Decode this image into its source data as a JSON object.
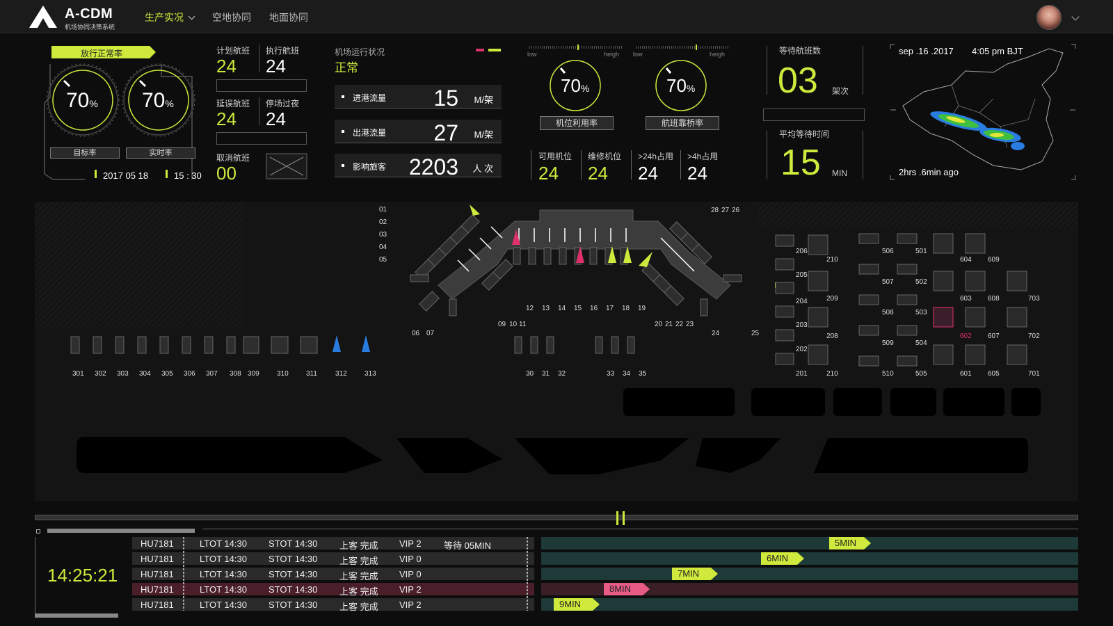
{
  "header": {
    "brand": "A-CDM",
    "brand_sub": "机场协同决策系统",
    "nav": [
      {
        "label": "生产实况",
        "active": true
      },
      {
        "label": "空地协同",
        "active": false
      },
      {
        "label": "地面协同",
        "active": false
      }
    ]
  },
  "release": {
    "title": "放行正常率",
    "target_rate": "70",
    "actual_rate": "70",
    "unit": "%",
    "target_label": "目标率",
    "actual_label": "实时率",
    "date": "2017 05 18",
    "time": "15 : 30"
  },
  "flights": {
    "planned_label": "计划航班",
    "planned": "24",
    "executed_label": "执行航班",
    "executed": "24",
    "delayed_label": "延误航班",
    "delayed": "24",
    "overnight_label": "停场过夜",
    "overnight": "24",
    "cancel_label": "取消航班",
    "cancel": "00"
  },
  "airport_status": {
    "label": "机场运行状况",
    "value": "正常",
    "rows": [
      {
        "name": "进港流量",
        "value": "15",
        "unit": "M/架"
      },
      {
        "name": "出港流量",
        "value": "27",
        "unit": "M/架"
      },
      {
        "name": "影响旅客",
        "value": "2203",
        "unit": "人 次"
      }
    ]
  },
  "utilization": {
    "low": "low",
    "high": "heigh",
    "stand_rate": "70",
    "stand_rate_label": "机位利用率",
    "bridge_rate": "70",
    "bridge_rate_label": "航班靠桥率",
    "unit": "%",
    "stats": [
      {
        "label": "可用机位",
        "value": "24"
      },
      {
        "label": "维修机位",
        "value": "24"
      },
      {
        "label": ">24h占用",
        "value": "24"
      },
      {
        "label": ">4h占用",
        "value": "24"
      }
    ]
  },
  "waiting": {
    "count_label": "等待航班数",
    "count": "03",
    "count_unit": "架次",
    "avg_label": "平均等待时间",
    "avg": "15",
    "avg_unit": "MIN"
  },
  "weather": {
    "date": "sep .16 .2017",
    "time": "4:05 pm  BJT",
    "ago": "2hrs .6min ago"
  },
  "apron": {
    "remote_left": [
      "301",
      "302",
      "303",
      "304",
      "305",
      "306",
      "307",
      "308",
      "309",
      "310",
      "311",
      "312",
      "313"
    ],
    "pier_left": [
      "01",
      "02",
      "03",
      "04",
      "05"
    ],
    "bottom_mid": [
      "06",
      "07",
      "09",
      "10",
      "11",
      "12",
      "13",
      "14",
      "15",
      "16",
      "17",
      "18",
      "19",
      "20",
      "21",
      "22",
      "23",
      "24",
      "25"
    ],
    "top_right": [
      "28",
      "27",
      "26"
    ],
    "bottom_row": [
      "30",
      "31",
      "32",
      "33",
      "34",
      "35"
    ],
    "east_col1": [
      "206",
      "205",
      "204",
      "203",
      "202",
      "201"
    ],
    "east_col2": [
      "210",
      "209",
      "208",
      "210"
    ],
    "east_col3": [
      "506",
      "507",
      "508",
      "509",
      "510"
    ],
    "east_col4": [
      "501",
      "502",
      "503",
      "504",
      "505"
    ],
    "east_col5": [
      "604",
      "603",
      "602",
      "601"
    ],
    "east_col6": [
      "609",
      "608",
      "607",
      "605"
    ],
    "east_col7": [
      "703",
      "702",
      "701"
    ]
  },
  "timeline": {
    "clock": "14:25:21",
    "rows": [
      {
        "flight": "HU7181",
        "ltot": "LTOT  14:30",
        "stot": "STOT  14:30",
        "board": "上客  完成",
        "vip": "VIP  2",
        "wait": "等待  05MIN",
        "bar": "5MIN",
        "alert": false
      },
      {
        "flight": "HU7181",
        "ltot": "LTOT  14:30",
        "stot": "STOT  14:30",
        "board": "上客  完成",
        "vip": "VIP  0",
        "wait": "",
        "bar": "6MIN",
        "alert": false
      },
      {
        "flight": "HU7181",
        "ltot": "LTOT  14:30",
        "stot": "STOT  14:30",
        "board": "上客  完成",
        "vip": "VIP  0",
        "wait": "",
        "bar": "7MIN",
        "alert": false
      },
      {
        "flight": "HU7181",
        "ltot": "LTOT  14:30",
        "stot": "STOT  14:30",
        "board": "上客  完成",
        "vip": "VIP  2",
        "wait": "",
        "bar": "8MIN",
        "alert": true
      },
      {
        "flight": "HU7181",
        "ltot": "LTOT  14:30",
        "stot": "STOT  14:30",
        "board": "上客  完成",
        "vip": "VIP  2",
        "wait": "",
        "bar": "9MIN",
        "alert": false
      }
    ]
  },
  "colors": {
    "accent": "#cfe93c",
    "alert": "#e0306a",
    "blue": "#2a7de0"
  }
}
